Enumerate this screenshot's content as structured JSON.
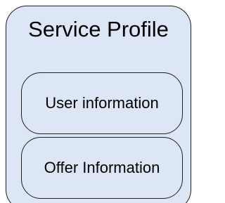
{
  "diagram": {
    "outer": {
      "title": "Service Profile"
    },
    "inner": [
      {
        "label": "User information"
      },
      {
        "label": "Offer Information"
      }
    ],
    "colors": {
      "fill": "#dde6f4",
      "stroke": "#1f1f1f",
      "text": "#000000"
    }
  }
}
